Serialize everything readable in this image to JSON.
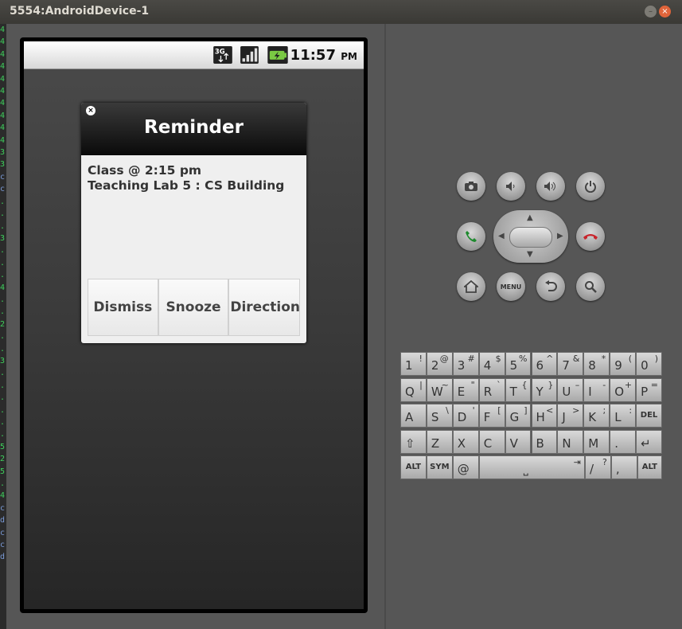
{
  "window": {
    "title": "5554:AndroidDevice-1",
    "minimize": "–",
    "close": "×"
  },
  "terminal_strip": [
    "4",
    "4",
    "4",
    "4",
    "4",
    "4",
    "4",
    "4",
    "4",
    "4",
    "3",
    "3",
    "c",
    "c",
    ".",
    ".",
    ".",
    "3",
    ".",
    ".",
    ".",
    "4",
    ".",
    ".",
    "2",
    ".",
    ".",
    "3",
    ".",
    ".",
    ".",
    ".",
    ".",
    ".",
    "5",
    "2",
    "5",
    ".",
    "4",
    "c",
    "d",
    "c",
    "c",
    "d"
  ],
  "status_bar": {
    "time": "11:57",
    "ampm": "PM",
    "icons": [
      "3g-icon",
      "signal-icon",
      "battery-charging-icon"
    ]
  },
  "dialog": {
    "title": "Reminder",
    "close_glyph": "×",
    "lines": [
      "Class @ 2:15 pm",
      "Teaching Lab 5 : CS Building"
    ],
    "buttons": [
      "Dismiss",
      "Snooze",
      "Directions"
    ]
  },
  "hardware": {
    "menu_label": "MENU"
  },
  "keyboard": {
    "row1": [
      [
        "1",
        "!"
      ],
      [
        "2",
        "@"
      ],
      [
        "3",
        "#"
      ],
      [
        "4",
        "$"
      ],
      [
        "5",
        "%"
      ],
      [
        "6",
        "^"
      ],
      [
        "7",
        "&"
      ],
      [
        "8",
        "*"
      ],
      [
        "9",
        "("
      ],
      [
        "0",
        ")"
      ]
    ],
    "row2": [
      [
        "Q",
        "|"
      ],
      [
        "W",
        "~"
      ],
      [
        "E",
        "\""
      ],
      [
        "R",
        "`"
      ],
      [
        "T",
        "{"
      ],
      [
        "Y",
        "}"
      ],
      [
        "U",
        "–"
      ],
      [
        "I",
        "-"
      ],
      [
        "O",
        "+"
      ],
      [
        "P",
        "="
      ]
    ],
    "row3": [
      [
        "A",
        ""
      ],
      [
        "S",
        "\\"
      ],
      [
        "D",
        "'"
      ],
      [
        "F",
        "["
      ],
      [
        "G",
        "]"
      ],
      [
        "H",
        "<"
      ],
      [
        "J",
        ">"
      ],
      [
        "K",
        ";"
      ],
      [
        "L",
        ":"
      ],
      [
        "DEL",
        ""
      ]
    ],
    "row4": [
      [
        "⇧",
        ""
      ],
      [
        "Z",
        ""
      ],
      [
        "X",
        ""
      ],
      [
        "C",
        ""
      ],
      [
        "V",
        ""
      ],
      [
        "B",
        ""
      ],
      [
        "N",
        ""
      ],
      [
        "M",
        ""
      ],
      [
        ".",
        ""
      ],
      [
        "↵",
        ""
      ]
    ],
    "row5": {
      "alt": "ALT",
      "sym": "SYM",
      "at": "@",
      "space": "⎵",
      "tab": "⇥",
      "slash": "/",
      "question": "?",
      "comma": ",",
      "alt2": "ALT"
    }
  }
}
